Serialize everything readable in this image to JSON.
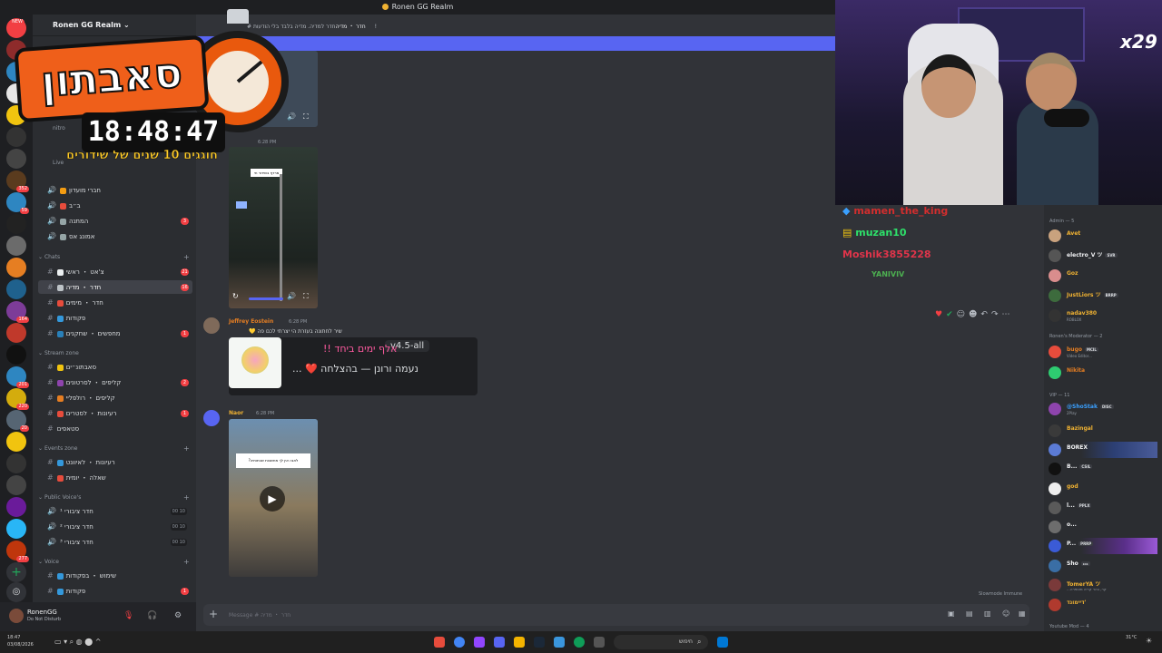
{
  "window": {
    "title": "Ronen GG Realm"
  },
  "server": {
    "name": "Ronen GG Realm ⌄"
  },
  "rail_badges": [
    "NEW",
    "352",
    "59",
    "164",
    "201",
    "220",
    "20",
    "277"
  ],
  "sidebar": {
    "partial_labels": [
      "nitro",
      "Live"
    ],
    "top_channels": [
      {
        "name": "חברי מועדון",
        "count": ""
      },
      {
        "name": "ב״ב",
        "count": ""
      },
      {
        "name": "המתנה",
        "count": "3"
      },
      {
        "name": "אמונג אס",
        "count": ""
      }
    ],
    "categories": {
      "chats": "Chats",
      "stream_zone": "Stream zone",
      "events_zone": "Events zone",
      "public_voices": "Public Voice's",
      "voice": "Voice"
    },
    "chats": [
      {
        "name": "צ'אט ・ ראשי",
        "count": "21"
      },
      {
        "name": "חדר ・ מדיה",
        "count": "16"
      },
      {
        "name": "חדר ・ מימים",
        "count": ""
      },
      {
        "name": "פקודות",
        "count": ""
      },
      {
        "name": "מחפשים ・ שחקנים",
        "count": "1"
      }
    ],
    "stream": [
      {
        "name": "סאבתונ״ים",
        "count": ""
      },
      {
        "name": "קליפים ・ לסרטונים",
        "count": "2"
      },
      {
        "name": "קליפים ・ רולפליי",
        "count": ""
      },
      {
        "name": "רעיונות ・ לסטרים",
        "count": "1"
      },
      {
        "name": "סטאפים",
        "count": ""
      }
    ],
    "events": [
      {
        "name": "רעיונות ・ לאיוונט",
        "count": ""
      },
      {
        "name": "שאלה ・ יומית",
        "count": ""
      }
    ],
    "public_voice": [
      {
        "name": "חדר ציבורי ¹",
        "count": "00 10"
      },
      {
        "name": "חדר ציבורי ²",
        "count": "00 10"
      },
      {
        "name": "חדר ציבורי ³",
        "count": "00 10"
      }
    ],
    "voice": [
      {
        "name": "שימוש ・ בפקודות",
        "count": ""
      },
      {
        "name": "פקודות",
        "count": "1"
      }
    ]
  },
  "user": {
    "name": "RonenGG",
    "status": "Do Not Disturb"
  },
  "channel": {
    "header_text": "חדר ・ מדיה",
    "topic": "חדר למדיה. מדיה בלבד בלי הודעות!"
  },
  "messages": [
    {
      "time": "6:28 PM",
      "video_caption": "מרדף בשידור חי"
    },
    {
      "author": "Jeffrey Eostein",
      "time": "6:28 PM",
      "text": "שיר לחתונה בעזרת הי יצרתי לכם פה 💛",
      "embed": {
        "title": "אלף ימים ביחד !!",
        "subtitle": "נעמה ורונן — בהצלחה ❤️ ...",
        "tag": "v4.5-all"
      }
    },
    {
      "author": "Naor",
      "time": "6:28 PM",
      "video_caption": "לאנה אין לך מחשבות שבתותיה?"
    }
  ],
  "composer": {
    "placeholder": "Message # חדר ・ מדיה",
    "slowmode": "Slowmode Immune"
  },
  "members": {
    "groups": {
      "admin": "Admin — 5",
      "moderator": "Ronen's Moderator — 2",
      "vip": "VIP — 11",
      "youtube": "Youtube Mod — 4"
    },
    "admin": [
      {
        "name": "Avet",
        "sub": "",
        "tag": "",
        "color": "#f0b232"
      },
      {
        "name": "electro_V ツ",
        "sub": "",
        "tag": "SVR",
        "color": "#f2f3f5"
      },
      {
        "name": "Goz",
        "sub": "",
        "tag": "",
        "color": "#f0b232"
      },
      {
        "name": "JustLiors ツ",
        "sub": "",
        "tag": "BRRP",
        "color": "#f0b232"
      },
      {
        "name": "nadav380",
        "sub": "ROBLOX",
        "tag": "",
        "color": "#f0b232"
      }
    ],
    "moderator": [
      {
        "name": "bugo",
        "sub": "Video Editor...",
        "tag": "MCIL",
        "color": "#e67e22"
      },
      {
        "name": "Nikita",
        "sub": "",
        "tag": "",
        "color": "#e67e22"
      }
    ],
    "vip": [
      {
        "name": "@ShoStak",
        "sub": "2Play",
        "tag": "DISC",
        "color": "#3aa0ff"
      },
      {
        "name": "Bazingal",
        "sub": "",
        "tag": "",
        "color": "#f0b232"
      },
      {
        "name": "BOREX",
        "sub": "",
        "tag": "",
        "color": "#f2f3f5"
      },
      {
        "name": "B...",
        "sub": "",
        "tag": "CSIL",
        "color": "#f2f3f5"
      },
      {
        "name": "god",
        "sub": "",
        "tag": "",
        "color": "#f0b232"
      },
      {
        "name": "l...",
        "sub": "",
        "tag": "PPLX",
        "color": "#f2f3f5"
      },
      {
        "name": "o...",
        "sub": "",
        "tag": "",
        "color": "#f2f3f5"
      },
      {
        "name": "P...",
        "sub": "",
        "tag": "PRRP",
        "color": "#f2f3f5"
      },
      {
        "name": "Sho",
        "sub": "",
        "tag": "נכנ",
        "color": "#f2f3f5"
      },
      {
        "name": "TomerYA ツ",
        "sub": "...קר, בהר קריה מוטפרה",
        "tag": "",
        "color": "#f0b232"
      },
      {
        "name": "דיימונד'",
        "sub": "",
        "tag": "",
        "color": "#f0b232"
      }
    ]
  },
  "stream_chat": [
    {
      "user": "mamen_the_king",
      "color": "#d12e2e"
    },
    {
      "user": "muzan10",
      "color": "#2ee06a"
    },
    {
      "user": "Moshik3855228",
      "color": "#e0344a"
    },
    {
      "user": "YANIVIV",
      "color": "#4caf50"
    }
  ],
  "webcam": {
    "badge": "x29"
  },
  "overlay": {
    "title": "סאבתון",
    "timer": "18:48:47",
    "subtitle": "חוגגים 10 שנים של שידורים"
  },
  "taskbar": {
    "time": "18:47",
    "date": "03/08/2026",
    "weather": "31°C",
    "search_placeholder": "חיפוש"
  }
}
